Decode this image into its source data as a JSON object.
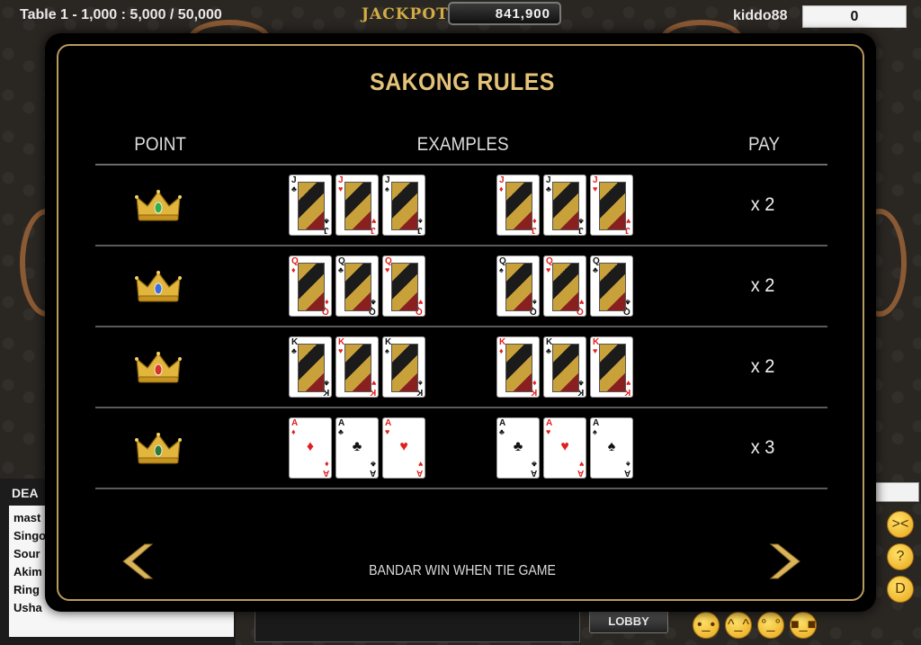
{
  "topbar": {
    "table_info": "Table 1 - 1,000 : 5,000 / 50,000",
    "jackpot_label": "JACKPOT",
    "jackpot_value": "841,900",
    "username": "kiddo88",
    "user_chips": "0"
  },
  "background": {
    "dealer_title": "DEA",
    "dealer_list": [
      "mast",
      "Singo",
      "Sour",
      "Akim",
      "Ring",
      "Usha"
    ],
    "lobby_label": "LOBBY",
    "emojis": [
      "neutral-face-icon",
      "blush-face-icon",
      "glasses-face-icon",
      "cool-face-icon",
      "laugh-face-icon",
      "think-face-icon",
      "grin-face-icon"
    ]
  },
  "modal": {
    "title": "SAKONG RULES",
    "headers": {
      "point": "POINT",
      "examples": "EXAMPLES",
      "pay": "PAY"
    },
    "footer_note": "BANDAR WIN WHEN TIE GAME",
    "prev_icon": "chevron-left-icon",
    "next_icon": "chevron-right-icon",
    "rows": [
      {
        "crown_gem": "#2fae4a",
        "pay": "x 2",
        "left": [
          {
            "rank": "J",
            "suit": "♣",
            "color": "black",
            "face": true
          },
          {
            "rank": "J",
            "suit": "♥",
            "color": "red",
            "face": true
          },
          {
            "rank": "J",
            "suit": "♠",
            "color": "black",
            "face": true
          }
        ],
        "right": [
          {
            "rank": "J",
            "suit": "♦",
            "color": "red",
            "face": true
          },
          {
            "rank": "J",
            "suit": "♣",
            "color": "black",
            "face": true
          },
          {
            "rank": "J",
            "suit": "♥",
            "color": "red",
            "face": true
          }
        ]
      },
      {
        "crown_gem": "#3a6ed8",
        "pay": "x 2",
        "left": [
          {
            "rank": "Q",
            "suit": "♦",
            "color": "red",
            "face": true
          },
          {
            "rank": "Q",
            "suit": "♣",
            "color": "black",
            "face": true
          },
          {
            "rank": "Q",
            "suit": "♥",
            "color": "red",
            "face": true
          }
        ],
        "right": [
          {
            "rank": "Q",
            "suit": "♠",
            "color": "black",
            "face": true
          },
          {
            "rank": "Q",
            "suit": "♥",
            "color": "red",
            "face": true
          },
          {
            "rank": "Q",
            "suit": "♣",
            "color": "black",
            "face": true
          }
        ]
      },
      {
        "crown_gem": "#d6342a",
        "pay": "x 2",
        "left": [
          {
            "rank": "K",
            "suit": "♣",
            "color": "black",
            "face": true
          },
          {
            "rank": "K",
            "suit": "♥",
            "color": "red",
            "face": true
          },
          {
            "rank": "K",
            "suit": "♠",
            "color": "black",
            "face": true
          }
        ],
        "right": [
          {
            "rank": "K",
            "suit": "♦",
            "color": "red",
            "face": true
          },
          {
            "rank": "K",
            "suit": "♣",
            "color": "black",
            "face": true
          },
          {
            "rank": "K",
            "suit": "♥",
            "color": "red",
            "face": true
          }
        ]
      },
      {
        "crown_gem": "#2b7a3c",
        "pay": "x 3",
        "left": [
          {
            "rank": "A",
            "suit": "♦",
            "color": "red",
            "face": false
          },
          {
            "rank": "A",
            "suit": "♣",
            "color": "black",
            "face": false
          },
          {
            "rank": "A",
            "suit": "♥",
            "color": "red",
            "face": false
          }
        ],
        "right": [
          {
            "rank": "A",
            "suit": "♣",
            "color": "black",
            "face": false
          },
          {
            "rank": "A",
            "suit": "♥",
            "color": "red",
            "face": false
          },
          {
            "rank": "A",
            "suit": "♠",
            "color": "black",
            "face": false
          }
        ]
      }
    ]
  }
}
